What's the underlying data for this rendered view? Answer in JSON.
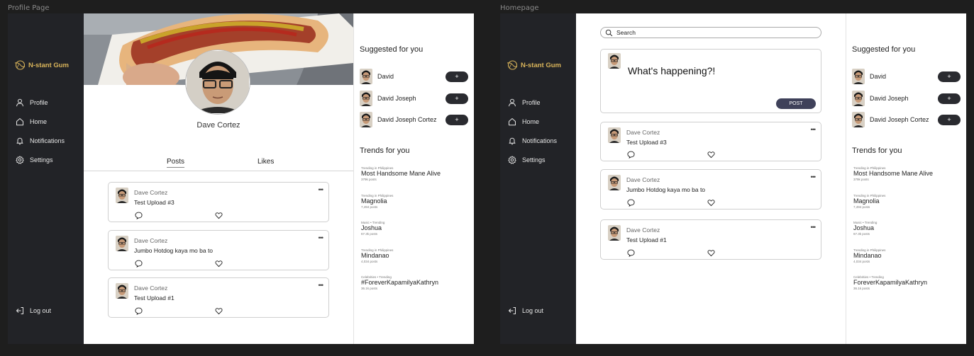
{
  "frames": {
    "profile_label": "Profile Page",
    "home_label": "Homepage"
  },
  "brand": {
    "name": "N-stant Gum",
    "color": "#d9b45a"
  },
  "nav": [
    {
      "label": "Profile",
      "icon": "user-icon"
    },
    {
      "label": "Home",
      "icon": "home-icon"
    },
    {
      "label": "Notifications",
      "icon": "bell-icon"
    },
    {
      "label": "Settings",
      "icon": "gear-icon"
    }
  ],
  "logout_label": "Log out",
  "profile": {
    "name": "Dave Cortez",
    "tabs": [
      {
        "label": "Posts",
        "active": true
      },
      {
        "label": "Likes",
        "active": false
      }
    ]
  },
  "home": {
    "search_placeholder": "Search",
    "composer_placeholder": "What's happening?!",
    "post_button": "POST"
  },
  "posts": [
    {
      "author": "Dave Cortez",
      "text": "Test Upload #3"
    },
    {
      "author": "Dave Cortez",
      "text": "Jumbo Hotdog kaya mo ba to"
    },
    {
      "author": "Dave Cortez",
      "text": "Test Upload #1"
    }
  ],
  "more_glyph": "•••",
  "suggested": {
    "title": "Suggested for you",
    "follow_label": "+",
    "users": [
      {
        "name": "David"
      },
      {
        "name": "David Joseph"
      },
      {
        "name": "David Joseph Cortez"
      }
    ]
  },
  "trends": {
    "title": "Trends for you",
    "profile_items": [
      {
        "category": "Trending in Philippines",
        "topic": "Most Handsome Mane Alive",
        "count": "379k posts"
      },
      {
        "category": "Trending in Philippines",
        "topic": "Magnolia",
        "count": "7,494 posts"
      },
      {
        "category": "Music • Trending",
        "topic": "Joshua",
        "count": "67.3k posts"
      },
      {
        "category": "Trending in Philippines",
        "topic": "Mindanao",
        "count": "4,034 posts"
      },
      {
        "category": "Celebrities • Trending",
        "topic": "#ForeverKapamilyaKathryn",
        "count": "36.1k posts"
      }
    ],
    "home_items": [
      {
        "category": "Trending in Philippines",
        "topic": "Most Handsome Mane Alive",
        "count": "379k posts"
      },
      {
        "category": "Trending in Philippines",
        "topic": "Magnolia",
        "count": "7,494 posts"
      },
      {
        "category": "Music • Trending",
        "topic": "Joshua",
        "count": "67.3k posts"
      },
      {
        "category": "Trending in Philippines",
        "topic": "Mindanao",
        "count": "4,034 posts"
      },
      {
        "category": "Celebrities • Trending",
        "topic": "ForeverKapamilyaKathryn",
        "count": "36.1k posts"
      }
    ]
  }
}
